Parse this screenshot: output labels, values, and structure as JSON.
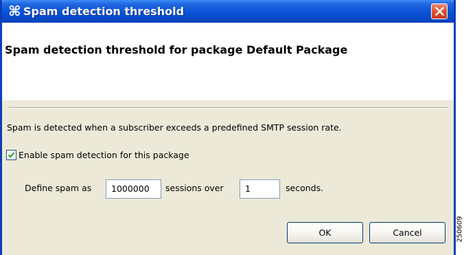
{
  "window": {
    "title": "Spam detection threshold",
    "title_icon": "cisco-app-icon",
    "close_icon": "close-icon"
  },
  "header": {
    "title": "Spam detection threshold for package Default Package"
  },
  "body": {
    "description": "Spam is detected when a subscriber exceeds a predefined SMTP session rate.",
    "enable_checkbox": {
      "label": "Enable spam detection for this package",
      "checked": true
    },
    "define": {
      "prefix": "Define spam as",
      "sessions_value": "1000000",
      "middle": "sessions over",
      "seconds_value": "1",
      "suffix": "seconds."
    }
  },
  "buttons": {
    "ok_label": "OK",
    "cancel_label": "Cancel"
  },
  "side_label": "250609",
  "colors": {
    "titlebar": "#0a53d8",
    "dialog_bg": "#ece9d8",
    "close_button": "#e0522e"
  }
}
